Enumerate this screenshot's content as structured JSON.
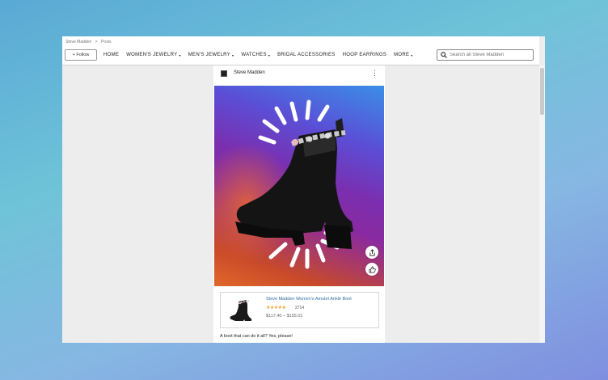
{
  "breadcrumb": [
    "Steve Madden",
    ">",
    "Posts"
  ],
  "header": {
    "follow_label": "+ Follow",
    "nav": [
      {
        "label": "HOME",
        "caret": ""
      },
      {
        "label": "WOMEN'S JEWELRY",
        "caret": "▾"
      },
      {
        "label": "MEN'S JEWELRY",
        "caret": "▾"
      },
      {
        "label": "WATCHES",
        "caret": "▾"
      },
      {
        "label": "BRIDAL ACCESSORIES",
        "caret": ""
      },
      {
        "label": "HOOP EARRINGS",
        "caret": ""
      },
      {
        "label": "MORE",
        "caret": "▾"
      }
    ],
    "search_placeholder": "Search all Steve Madden",
    "search_icon": "search-icon"
  },
  "post": {
    "brand_name": "Steve Madden",
    "more_icon": "more-vertical-icon",
    "share_icon": "share-icon",
    "like_icon": "thumbs-up-icon",
    "product": {
      "title": "Steve Madden Women's Amulet Ankle Boot",
      "rating": 4.5,
      "stars_text": "★★★★★",
      "review_count": "2714",
      "price": "$117.40 – $155.01"
    },
    "caption": "A boot that can do it all? Yes, please!"
  },
  "colors": {
    "link": "#2f6fa8",
    "star": "#f3a12a",
    "accent_nav": "#c0392b"
  }
}
